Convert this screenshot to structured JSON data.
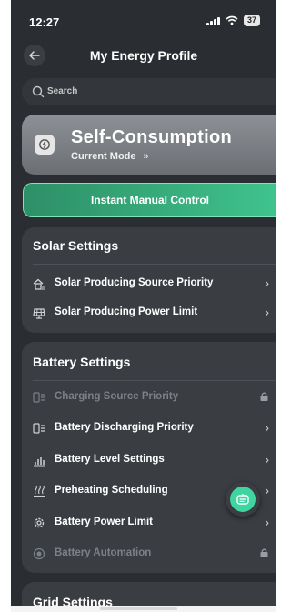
{
  "status": {
    "time": "12:27",
    "battery": "37"
  },
  "nav": {
    "title": "My Energy Profile"
  },
  "search": {
    "placeholder": "Search"
  },
  "mode": {
    "title": "Self-Consumption",
    "subtitle": "Current Mode",
    "chevron": "»"
  },
  "manual": {
    "label": "Instant Manual Control"
  },
  "solar": {
    "title": "Solar Settings",
    "items": [
      {
        "label": "Solar Producing Source Priority",
        "icon": "house-sun-icon",
        "locked": false
      },
      {
        "label": "Solar Producing Power Limit",
        "icon": "solar-panel-icon",
        "locked": false
      }
    ]
  },
  "battery_settings": {
    "title": "Battery Settings",
    "items": [
      {
        "label": "Charging Source Priority",
        "icon": "battery-list-icon",
        "locked": true
      },
      {
        "label": "Battery Discharging Priority",
        "icon": "battery-list-icon",
        "locked": false
      },
      {
        "label": "Battery Level Settings",
        "icon": "level-bars-icon",
        "locked": false
      },
      {
        "label": "Preheating Scheduling",
        "icon": "heat-waves-icon",
        "locked": false
      },
      {
        "label": "Battery Power Limit",
        "icon": "gear-icon",
        "locked": false
      },
      {
        "label": "Battery Automation",
        "icon": "automation-icon",
        "locked": true
      }
    ]
  },
  "grid": {
    "title": "Grid Settings"
  },
  "colors": {
    "accent": "#3fc38d",
    "background": "#2a2d31",
    "card": "#3a3d42"
  }
}
